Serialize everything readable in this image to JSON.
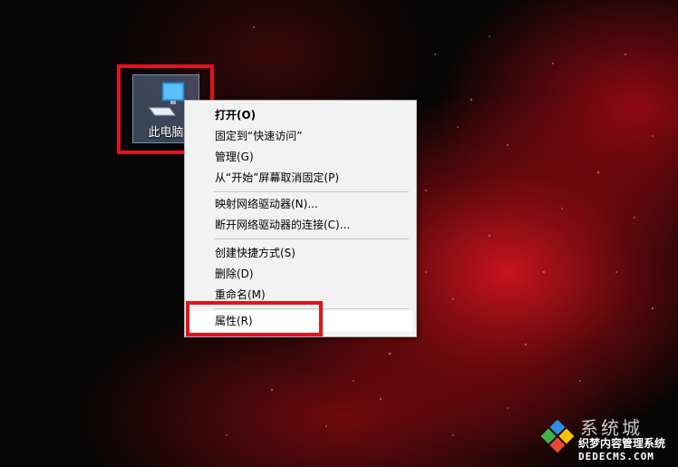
{
  "desktop": {
    "icon_label": "此电脑"
  },
  "context_menu": {
    "items": [
      {
        "label": "打开(O)"
      },
      {
        "label": "固定到“快速访问”"
      },
      {
        "label": "管理(G)"
      },
      {
        "label": "从“开始”屏幕取消固定(P)"
      },
      {
        "label": "映射网络驱动器(N)..."
      },
      {
        "label": "断开网络驱动器的连接(C)..."
      },
      {
        "label": "创建快捷方式(S)"
      },
      {
        "label": "删除(D)"
      },
      {
        "label": "重命名(M)"
      },
      {
        "label": "属性(R)"
      }
    ]
  },
  "watermark": {
    "title": "系统城",
    "subtitle": "织梦内容管理系统",
    "url": "DEDECMS.COM"
  },
  "colors": {
    "highlight_border": "#e0141e",
    "menu_bg": "#f2f2f2"
  }
}
